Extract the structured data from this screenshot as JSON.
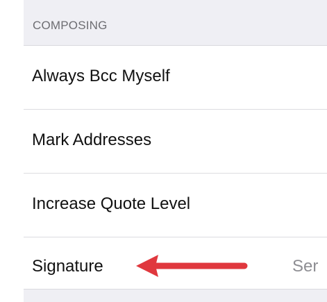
{
  "section": {
    "title": "COMPOSING"
  },
  "rows": [
    {
      "label": "Always Bcc Myself",
      "value": ""
    },
    {
      "label": "Mark Addresses",
      "value": ""
    },
    {
      "label": "Increase Quote Level",
      "value": ""
    },
    {
      "label": "Signature",
      "value": "Ser"
    }
  ],
  "annotation": {
    "arrow_color": "#e0383e",
    "points_to": "Signature"
  },
  "colors": {
    "header_bg": "#efeff4",
    "header_text": "#6d6d72",
    "row_text": "#111111",
    "value_text": "#8e8e93",
    "divider": "#dcdce0"
  }
}
